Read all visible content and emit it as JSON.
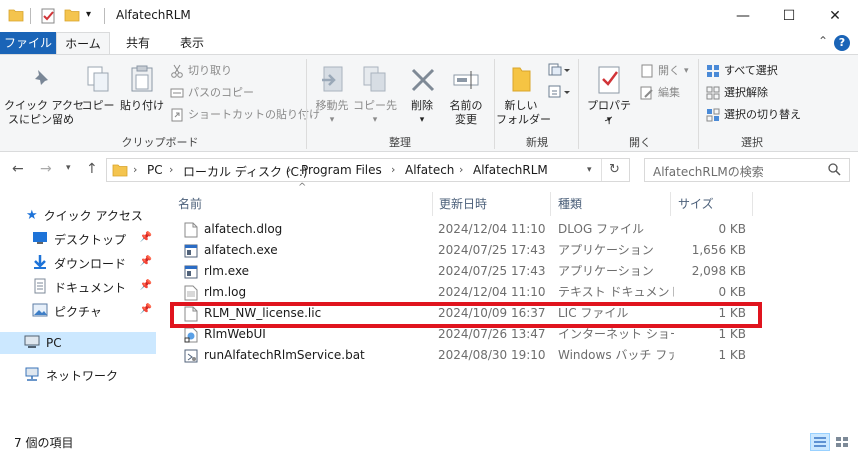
{
  "window": {
    "title": "AlfatechRLM",
    "minimize_glyph": "—",
    "maximize_glyph": "☐",
    "close_glyph": "✕"
  },
  "ribbon_tabs": {
    "file": "ファイル",
    "home": "ホーム",
    "share": "共有",
    "view": "表示",
    "collapse_glyph": "⌃",
    "help_glyph": "?"
  },
  "ribbon": {
    "clipboard": {
      "label": "クリップボード",
      "pin": "クイック アクセ\nスにピン留め",
      "copy": "コピー",
      "paste": "貼り付け",
      "cut": "切り取り",
      "copy_path": "パスのコピー",
      "paste_shortcut": "ショートカットの貼り付け"
    },
    "organize": {
      "label": "整理",
      "move_to": "移動先",
      "copy_to": "コピー先",
      "delete": "削除",
      "rename": "名前の\n変更"
    },
    "new": {
      "label": "新規",
      "new_folder": "新しい\nフォルダー"
    },
    "open": {
      "label": "開く",
      "properties": "プロパティ",
      "open": "開く",
      "edit": "編集"
    },
    "select": {
      "label": "選択",
      "select_all": "すべて選択",
      "select_none": "選択解除",
      "invert": "選択の切り替え"
    }
  },
  "address": {
    "crumbs": [
      "PC",
      "ローカル ディスク (C:)",
      "Program Files",
      "Alfatech",
      "AlfatechRLM"
    ],
    "search_placeholder": "AlfatechRLMの検索"
  },
  "nav_pane": {
    "quick_access": "クイック アクセス",
    "desktop": "デスクトップ",
    "downloads": "ダウンロード",
    "documents": "ドキュメント",
    "pictures": "ピクチャ",
    "pc": "PC",
    "network": "ネットワーク"
  },
  "columns": {
    "name": "名前",
    "date": "更新日時",
    "type": "種類",
    "size": "サイズ"
  },
  "files": [
    {
      "name": "alfatech.dlog",
      "date": "2024/12/04 11:10",
      "type": "DLOG ファイル",
      "size": "0 KB",
      "icon": "document-icon"
    },
    {
      "name": "alfatech.exe",
      "date": "2024/07/25 17:43",
      "type": "アプリケーション",
      "size": "1,656 KB",
      "icon": "application-icon"
    },
    {
      "name": "rlm.exe",
      "date": "2024/07/25 17:43",
      "type": "アプリケーション",
      "size": "2,098 KB",
      "icon": "application-icon"
    },
    {
      "name": "rlm.log",
      "date": "2024/12/04 11:10",
      "type": "テキスト ドキュメント",
      "size": "0 KB",
      "icon": "text-document-icon"
    },
    {
      "name": "RLM_NW_license.lic",
      "date": "2024/10/09 16:37",
      "type": "LIC ファイル",
      "size": "1 KB",
      "icon": "document-icon"
    },
    {
      "name": "RlmWebUI",
      "date": "2024/07/26 13:47",
      "type": "インターネット ショート...",
      "size": "1 KB",
      "icon": "internet-shortcut-icon"
    },
    {
      "name": "runAlfatechRlmService.bat",
      "date": "2024/08/30 19:10",
      "type": "Windows バッチ ファ...",
      "size": "1 KB",
      "icon": "batch-file-icon"
    }
  ],
  "status": {
    "item_count": "7 個の項目"
  },
  "colors": {
    "accent": "#1a64b7",
    "highlight_box": "#e0141e",
    "selection": "#cce8ff"
  }
}
